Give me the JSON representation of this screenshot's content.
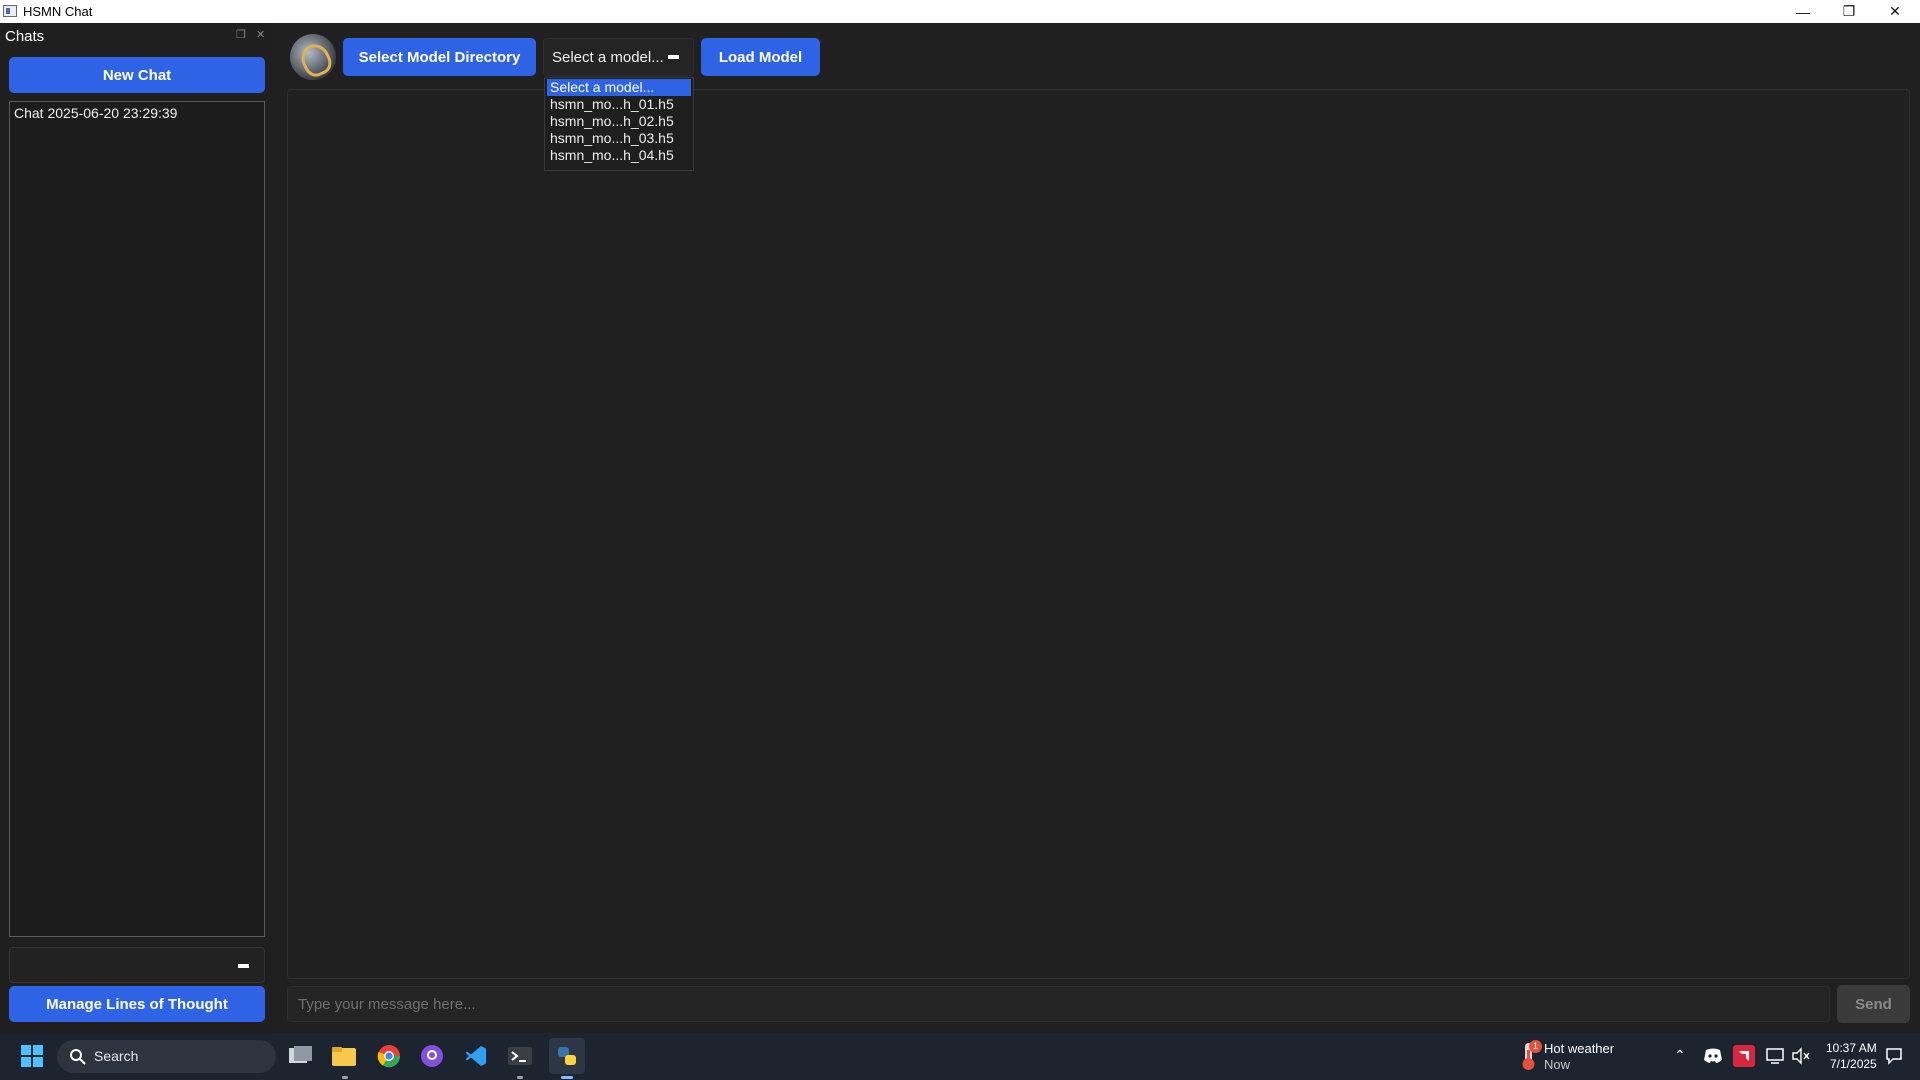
{
  "window": {
    "title": "HSMN Chat"
  },
  "sidebar": {
    "title": "Chats",
    "new_chat_label": "New Chat",
    "chat_items": [
      "Chat 2025-06-20 23:29:39"
    ],
    "manage_label": "Manage Lines of Thought"
  },
  "toolbar": {
    "select_dir_label": "Select Model Directory",
    "model_select_value": "Select a model...",
    "load_model_label": "Load Model"
  },
  "dropdown": {
    "options": [
      "Select a model...",
      "hsmn_mo...h_01.h5",
      "hsmn_mo...h_02.h5",
      "hsmn_mo...h_03.h5",
      "hsmn_mo...h_04.h5"
    ],
    "selected_index": 0
  },
  "composer": {
    "placeholder": "Type your message here...",
    "send_label": "Send"
  },
  "taskbar": {
    "search_label": "Search",
    "weather_title": "Hot weather",
    "weather_sub": "Now",
    "weather_badge": "1",
    "time": "10:37 AM",
    "date": "7/1/2025"
  },
  "colors": {
    "accent": "#2f63e6",
    "background": "#202020",
    "taskbar": "#1c2430"
  }
}
